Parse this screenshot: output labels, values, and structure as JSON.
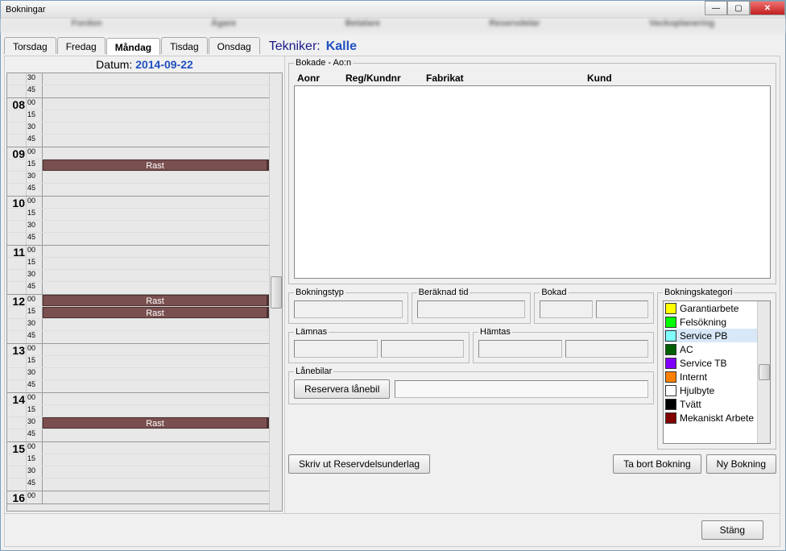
{
  "window": {
    "title": "Bokningar"
  },
  "blurred_bg": [
    "Fordon",
    "Ägare",
    "Betalare",
    "Reservdelar",
    "Veckoplanering"
  ],
  "tabs": [
    {
      "label": "Torsdag",
      "active": false
    },
    {
      "label": "Fredag",
      "active": false
    },
    {
      "label": "Måndag",
      "active": true
    },
    {
      "label": "Tisdag",
      "active": false
    },
    {
      "label": "Onsdag",
      "active": false
    }
  ],
  "tekniker_label": "Tekniker:",
  "tekniker_name": "Kalle",
  "datum_label": "Datum:",
  "datum_value": "2014-09-22",
  "timeline": {
    "pre": [
      "30",
      "45"
    ],
    "hours": [
      8,
      9,
      10,
      11,
      12,
      13,
      14,
      15,
      16
    ],
    "minutes": [
      "00",
      "15",
      "30",
      "45"
    ],
    "rast_label": "Rast",
    "rast_slots": [
      "09:15",
      "12:00",
      "12:15",
      "14:30"
    ]
  },
  "bokade": {
    "legend": "Bokade - Ao:n",
    "headers": {
      "aonr": "Aonr",
      "reg": "Reg/Kundnr",
      "fabrikat": "Fabrikat",
      "kund": "Kund"
    }
  },
  "fields": {
    "bokningstyp": "Bokningstyp",
    "beraknad": "Beräknad tid",
    "bokad": "Bokad",
    "lamnas": "Lämnas",
    "hamtas": "Hämtas",
    "lanebilar": "Lånebilar"
  },
  "kategori": {
    "legend": "Bokningskategori",
    "items": [
      {
        "label": "Garantiarbete",
        "color": "#ffff00",
        "selected": false
      },
      {
        "label": "Felsökning",
        "color": "#00ff00",
        "selected": false
      },
      {
        "label": "Service PB",
        "color": "#80ffff",
        "selected": true
      },
      {
        "label": "AC",
        "color": "#006000",
        "selected": false
      },
      {
        "label": "Service TB",
        "color": "#8000ff",
        "selected": false
      },
      {
        "label": "Internt",
        "color": "#ff8000",
        "selected": false
      },
      {
        "label": "Hjulbyte",
        "color": "#ffffff",
        "selected": false
      },
      {
        "label": "Tvätt",
        "color": "#000000",
        "selected": false
      },
      {
        "label": "Mekaniskt Arbete",
        "color": "#800000",
        "selected": false
      }
    ]
  },
  "buttons": {
    "reservera": "Reservera lånebil",
    "skrivut": "Skriv ut Reservdelsunderlag",
    "tabort": "Ta bort Bokning",
    "ny": "Ny Bokning",
    "stang": "Stäng"
  }
}
